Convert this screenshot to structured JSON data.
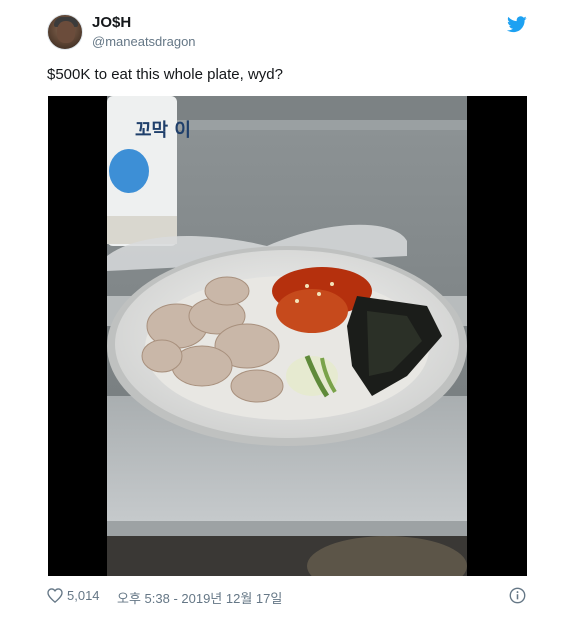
{
  "user": {
    "name": "JO$H",
    "handle": "@maneatsdragon"
  },
  "tweet": {
    "text": "$500K to eat this whole plate, wyd?"
  },
  "footer": {
    "likes": "5,014",
    "timestamp": "오후 5:38 - 2019년 12월 17일"
  },
  "photo": {
    "container_label_text": "꼬막 이"
  },
  "colors": {
    "twitter_blue": "#1da1f2",
    "text_primary": "#14171a",
    "text_secondary": "#657786",
    "media_background": "#000000"
  },
  "icons": {
    "bird": "twitter-bird-icon",
    "heart": "heart-icon",
    "info": "info-icon"
  }
}
